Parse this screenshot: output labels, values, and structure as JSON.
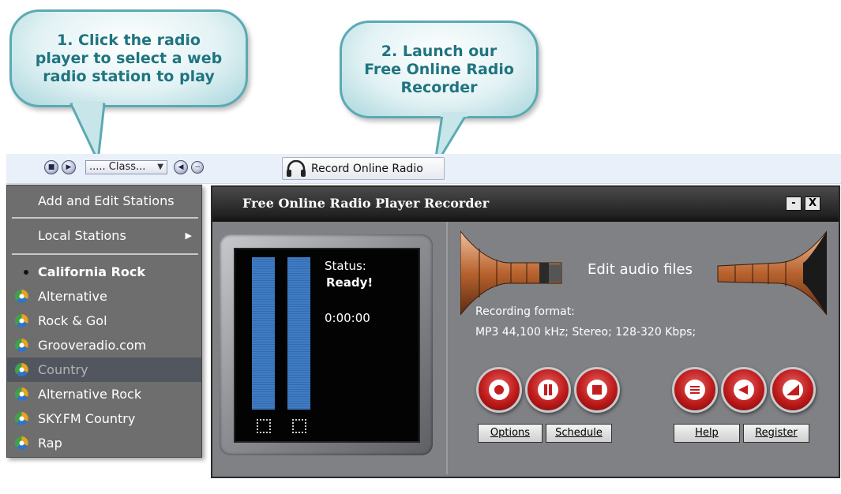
{
  "callouts": {
    "one": "1. Click the radio\nplayer to select a web\nradio station to play",
    "two": "2. Launch our\nFree Online Radio\nRecorder"
  },
  "toolbar": {
    "station_value": "..... Class...",
    "record_button_label": "Record Online Radio",
    "record_icon": "headphones-icon"
  },
  "menu": {
    "add_edit": "Add and Edit Stations",
    "local": "Local Stations",
    "stations": [
      {
        "label": "California Rock",
        "current": true,
        "selected": false
      },
      {
        "label": "Alternative",
        "current": false,
        "selected": false
      },
      {
        "label": "Rock & Gol",
        "current": false,
        "selected": false
      },
      {
        "label": "Grooveradio.com",
        "current": false,
        "selected": false
      },
      {
        "label": "Country",
        "current": false,
        "selected": true
      },
      {
        "label": "Alternative Rock",
        "current": false,
        "selected": false
      },
      {
        "label": "SKY.FM Country",
        "current": false,
        "selected": false
      },
      {
        "label": "Rap",
        "current": false,
        "selected": false
      }
    ]
  },
  "window": {
    "title": "Free Online Radio Player Recorder",
    "minimize_label": "-",
    "close_label": "X",
    "status_label": "Status:",
    "status_value": "Ready!",
    "time": "0:00:00",
    "edit_audio_label": "Edit audio files",
    "recording_format_label": "Recording format:",
    "recording_format_value": "MP3 44,100 kHz; Stereo;  128-320 Kbps;",
    "buttons": {
      "options": "Options",
      "schedule": "Schedule",
      "help": "Help",
      "register": "Register"
    }
  },
  "colors": {
    "callout_border": "#5aaab3",
    "callout_text": "#1f7480",
    "menu_bg": "#6e6e6e",
    "meter_blue": "#3e7cc4",
    "record_red": "#bf1b1b"
  }
}
